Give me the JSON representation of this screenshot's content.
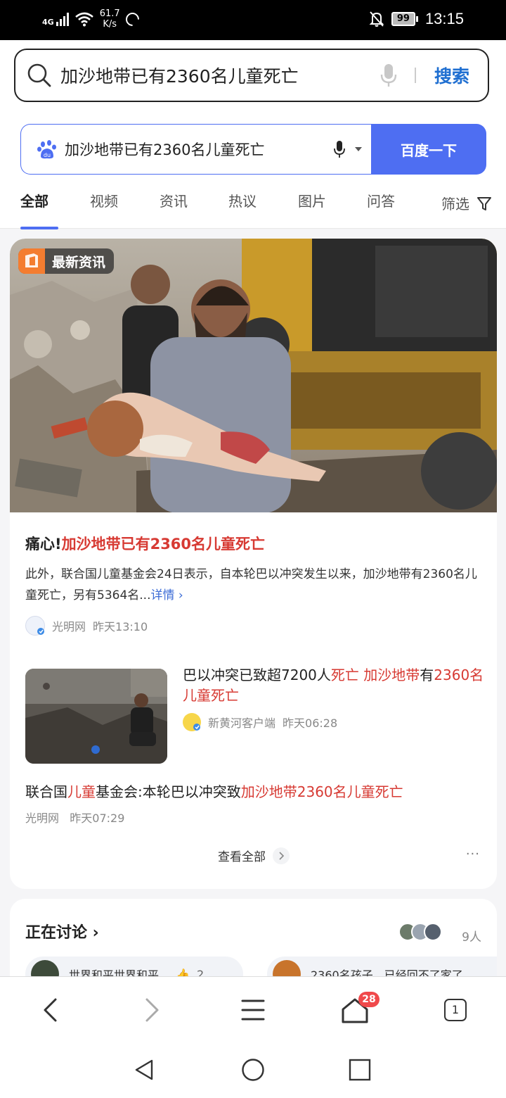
{
  "status_bar": {
    "network": "4G",
    "speed_value": "61.7",
    "speed_unit": "K/s",
    "battery": "99",
    "time": "13:15"
  },
  "browser": {
    "query": "加沙地带已有2360名儿童死亡",
    "search_button": "搜索"
  },
  "baidu": {
    "query": "加沙地带已有2360名儿童死亡",
    "search_button": "百度一下",
    "tabs": [
      "全部",
      "视频",
      "资讯",
      "热议",
      "图片",
      "问答"
    ],
    "active_tab": "全部",
    "filter_label": "筛选"
  },
  "news_card": {
    "badge": "最新资讯",
    "headline_prefix": "痛心!",
    "headline_highlight": "加沙地带已有2360名儿童死亡",
    "summary": "此外，联合国儿童基金会24日表示，自本轮巴以冲突发生以来，加沙地带有2360名儿童死亡，另有5364名...",
    "more_label": "详情",
    "source": "光明网",
    "time": "昨天13:10",
    "items": [
      {
        "title_parts": [
          "巴以冲突已致超7200人",
          "死亡",
          " ",
          "加沙地带",
          "有",
          "2360",
          "名儿童死亡"
        ],
        "source": "新黄河客户端",
        "time": "昨天06:28"
      },
      {
        "title_parts": [
          "联合国",
          "儿童",
          "基金会:本轮巴以冲突致",
          "加沙地带2360名儿童死亡"
        ],
        "source": "光明网",
        "time": "昨天07:29"
      }
    ],
    "view_all": "查看全部",
    "more_dots": "···"
  },
  "discussion": {
    "title": "正在讨论",
    "people_count": "9人",
    "chips": [
      {
        "text": "世界和平世界和平",
        "likes": "2"
      },
      {
        "text": "2360名孩子，已经回不了家了"
      }
    ]
  },
  "bottom_nav": {
    "home_badge": "28",
    "tabs_count": "1"
  },
  "colors": {
    "accent_blue": "#4e6ef2",
    "highlight_red": "#d73a33",
    "search_blue": "#1f6fd1",
    "badge_red": "#f0494b"
  }
}
